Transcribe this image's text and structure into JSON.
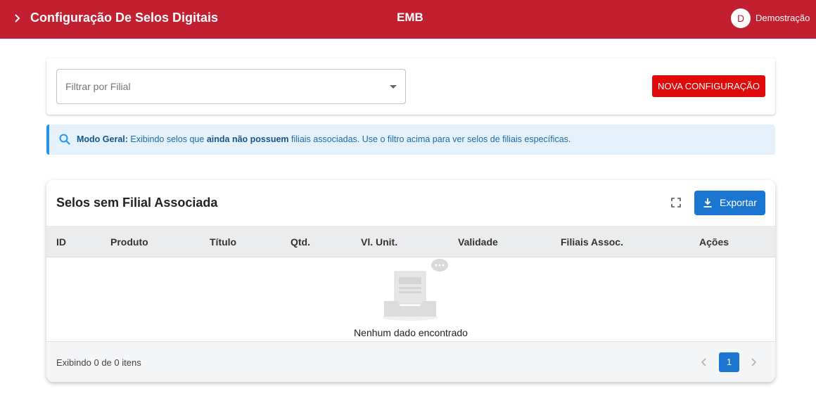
{
  "header": {
    "page_title": "Configuração De Selos Digitais",
    "brand": "EMB",
    "avatar_letter": "D",
    "user_name": "Demostração",
    "bg_color": "#c21f30"
  },
  "filter": {
    "placeholder": "Filtrar por Filial",
    "new_button_label": "NOVA CONFIGURAÇÃO"
  },
  "info_banner": {
    "icon": "search-icon",
    "lead": "Modo Geral:",
    "text_before": "Exibindo selos que",
    "emphasis": "ainda não possuem",
    "text_after": "filiais associadas. Use o filtro acima para ver selos de filiais específicas."
  },
  "table": {
    "title": "Selos sem Filial Associada",
    "export_label": "Exportar",
    "columns": [
      "ID",
      "Produto",
      "Título",
      "Qtd.",
      "Vl. Unit.",
      "Validade",
      "Filiais Assoc.",
      "Ações"
    ],
    "rows": [],
    "empty_text": "Nenhum dado encontrado",
    "footer_text": "Exibindo 0 de 0 itens",
    "current_page": "1"
  },
  "colors": {
    "primary_red": "#c21f30",
    "button_red": "#e00a0a",
    "primary_blue": "#1b76d2",
    "info_bg": "#e5f2fb"
  }
}
